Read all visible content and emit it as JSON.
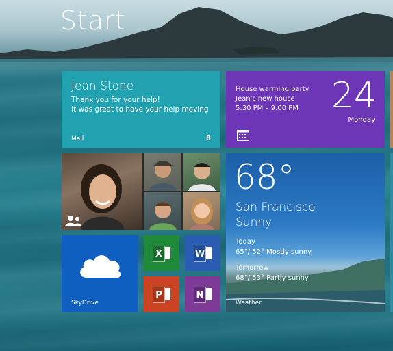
{
  "screen": {
    "title": "Start"
  },
  "mail": {
    "sender": "Jean Stone",
    "line1": "Thank you for your help!",
    "line2": "It was great to have your help moving",
    "app_label": "Mail",
    "unread_count": "8"
  },
  "calendar": {
    "event_title": "House warming party",
    "event_location": "Jean's new house",
    "event_time": "5:30 PM – 9:00 PM",
    "day_number": "24",
    "weekday": "Monday"
  },
  "weather": {
    "temperature": "68°",
    "city": "San Francisco",
    "condition": "Sunny",
    "today_label": "Today",
    "today_forecast": "65°/ 52° Mostly sunny",
    "tomorrow_label": "Tomorrow",
    "tomorrow_forecast": "68°/ 53° Partly sunny",
    "app_label": "Weather"
  },
  "skydrive": {
    "app_label": "SkyDrive"
  },
  "office": {
    "excel_letter": "X",
    "word_letter": "W",
    "powerpoint_letter": "P",
    "onenote_letter": "N"
  },
  "icons": {
    "calendar": "calendar-icon",
    "people": "people-icon",
    "cloud": "cloud-icon",
    "excel": "excel-icon",
    "word": "word-icon",
    "powerpoint": "powerpoint-icon",
    "onenote": "onenote-icon"
  },
  "colors": {
    "mail": "#22a1b0",
    "calendar": "#6c36b7",
    "skydrive": "#0f5fc0",
    "excel": "#1f8a3a",
    "word": "#2a5db2",
    "powerpoint": "#cc4323",
    "onenote": "#7d3a97"
  }
}
